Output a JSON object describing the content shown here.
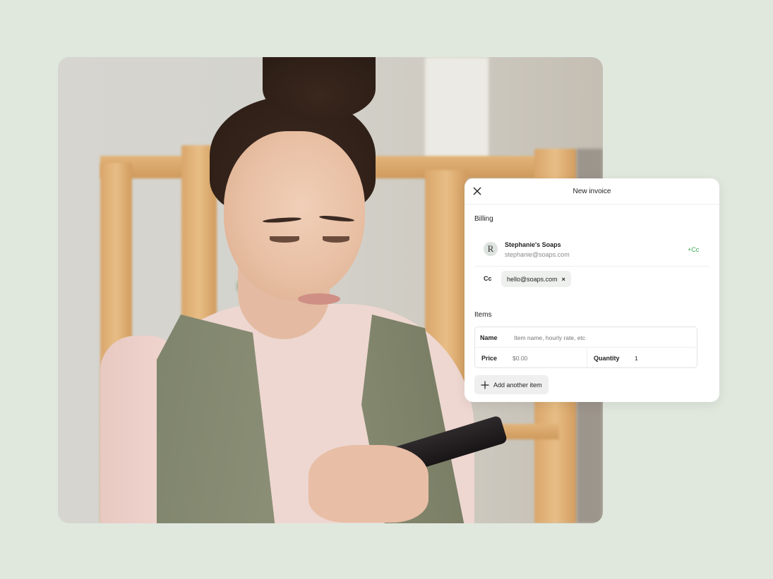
{
  "colors": {
    "page_background": "#e0e8de",
    "accent_green": "#3aaa55",
    "card_background": "#ffffff"
  },
  "photo": {
    "description": "Woman with hair in a bun looking at her smartphone in front of a wooden shelf"
  },
  "invoice": {
    "title": "New invoice",
    "close_icon": "close-icon",
    "billing": {
      "label": "Billing",
      "contact": {
        "avatar_initial": "R",
        "name": "Stephanie's Soaps",
        "email": "stephanie@soaps.com",
        "add_cc_label": "+Cc"
      },
      "cc": {
        "label": "Cc",
        "chips": [
          {
            "email": "hello@soaps.com",
            "remove_icon": "×"
          }
        ]
      }
    },
    "items": {
      "label": "Items",
      "name_field": {
        "label": "Name",
        "placeholder": "Item name, hourly rate, etc",
        "value": ""
      },
      "price_field": {
        "label": "Price",
        "placeholder": "$0.00",
        "value": ""
      },
      "quantity_field": {
        "label": "Quantity",
        "value": "1"
      },
      "add_button_label": "Add another item"
    }
  }
}
